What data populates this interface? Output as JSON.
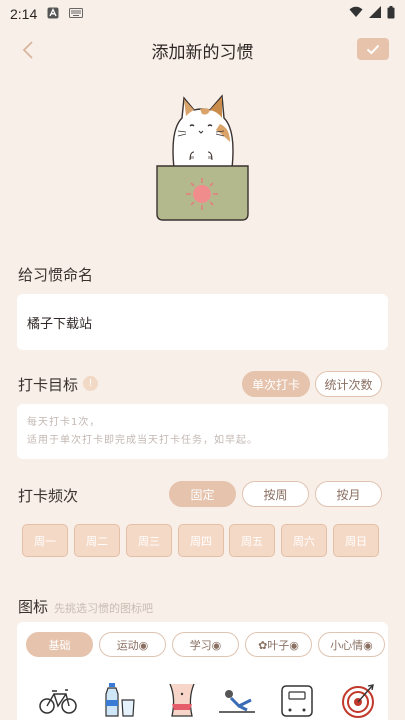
{
  "status_bar": {
    "time": "2:14"
  },
  "header": {
    "title": "添加新的习惯"
  },
  "name_section": {
    "label": "给习惯命名",
    "value": "橘子下载站"
  },
  "goal_section": {
    "label": "打卡目标",
    "options": [
      "单次打卡",
      "统计次数"
    ],
    "selected": "单次打卡",
    "hint_line1": "每天打卡1次，",
    "hint_line2": "适用于单次打卡即完成当天打卡任务，如早起。"
  },
  "frequency_section": {
    "label": "打卡频次",
    "options": [
      "固定",
      "按周",
      "按月"
    ],
    "selected": "固定",
    "weekdays": [
      "周一",
      "周二",
      "周三",
      "周四",
      "周五",
      "周六",
      "周日"
    ]
  },
  "icon_section": {
    "label": "图标",
    "hint": "先挑选习惯的图标吧",
    "categories": [
      "基础",
      "运动◉",
      "学习◉",
      "✿叶子◉",
      "小心情◉"
    ],
    "selected": "基础",
    "icons": [
      "bicycle-icon",
      "water-bottle-icon",
      "body-shape-icon",
      "situp-icon",
      "scale-icon",
      "target-icon"
    ]
  },
  "colors": {
    "background": "#f7efe8",
    "accent": "#e5c3ad",
    "pot": "#b3b98d",
    "sun": "#f08c8c"
  }
}
